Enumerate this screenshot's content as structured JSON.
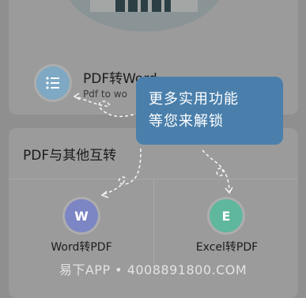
{
  "feature": {
    "title": "PDF转Word",
    "subtitle": "Pdf to wo"
  },
  "section": {
    "title": "PDF与其他互转"
  },
  "grid": [
    {
      "label": "Word转PDF",
      "icon": "word-icon",
      "glyph": "W",
      "color": "#7c86c4"
    },
    {
      "label": "Excel转PDF",
      "icon": "excel-icon",
      "glyph": "E",
      "color": "#5fb79e"
    }
  ],
  "tooltip": {
    "line1": "更多实用功能",
    "line2": "等您来解锁"
  },
  "watermark": "易下APP • 4008891800.COM"
}
